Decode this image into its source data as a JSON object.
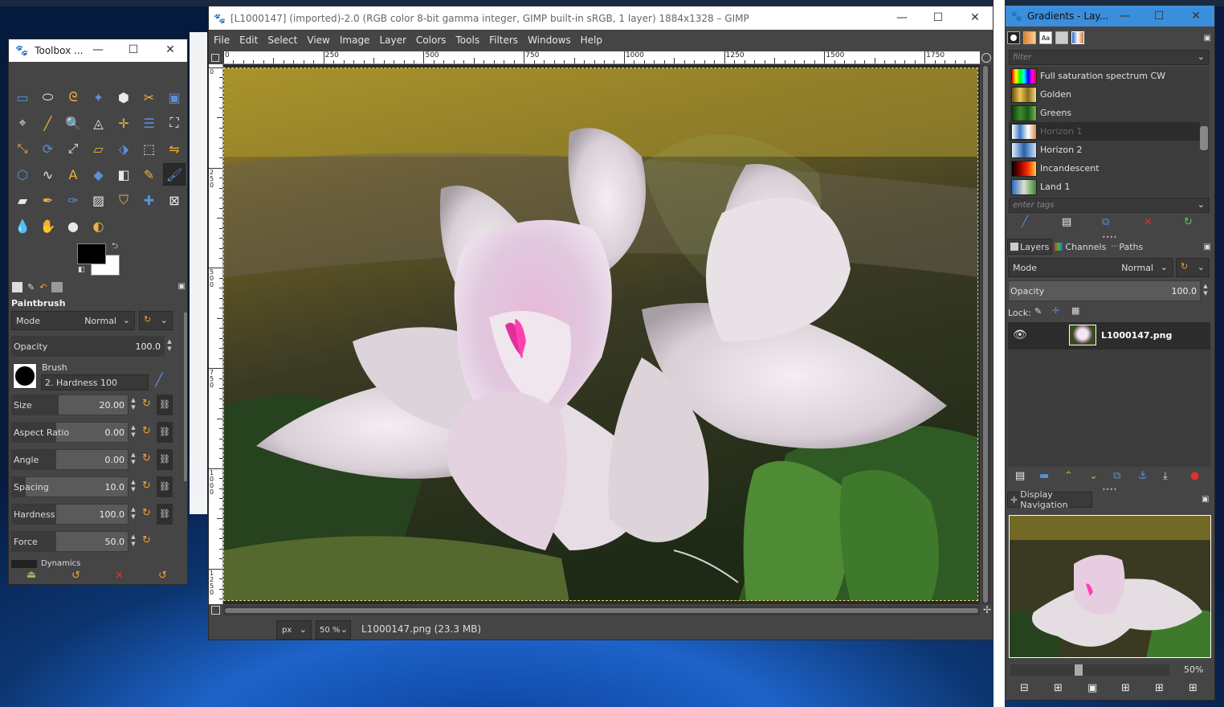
{
  "colors": {
    "accent": "#f0a030",
    "canvas_bg": "#2b2b2b",
    "panel": "#454545"
  },
  "toolbox": {
    "title": "Toolbox ...",
    "tools": [
      "rectangle-select",
      "ellipse-select",
      "free-select",
      "fuzzy-select",
      "select-by-color",
      "scissors-select",
      "foreground-select",
      "paths",
      "color-picker",
      "zoom",
      "measure",
      "move",
      "align",
      "crop",
      "unified-transform",
      "rotate",
      "scale",
      "shear",
      "perspective",
      "transform-3d",
      "flip",
      "cage-transform",
      "warp-transform",
      "text",
      "bucket-fill",
      "gradient",
      "pencil",
      "paintbrush",
      "eraser",
      "airbrush",
      "ink",
      "mypaint-brush",
      "clone",
      "heal",
      "perspective-clone",
      "smudge",
      "blur-sharpen",
      "dodge-burn",
      "handle-transform"
    ],
    "tool_options_title": "Paintbrush",
    "mode_label": "Mode",
    "mode_value": "Normal",
    "opacity_label": "Opacity",
    "opacity_value": "100.0",
    "brush_label": "Brush",
    "brush_value": "2. Hardness 100",
    "size_label": "Size",
    "size_value": "20.00",
    "aspect_label": "Aspect Ratio",
    "aspect_value": "0.00",
    "angle_label": "Angle",
    "angle_value": "0.00",
    "spacing_label": "Spacing",
    "spacing_value": "10.0",
    "hardness_label": "Hardness",
    "hardness_value": "100.0",
    "force_label": "Force",
    "force_value": "50.0",
    "dynamics_label": "Dynamics"
  },
  "image_window": {
    "title": "[L1000147] (imported)-2.0 (RGB color 8-bit gamma integer, GIMP built-in sRGB, 1 layer) 1884x1328 – GIMP",
    "menu": [
      "File",
      "Edit",
      "Select",
      "View",
      "Image",
      "Layer",
      "Colors",
      "Tools",
      "Filters",
      "Windows",
      "Help"
    ],
    "ruler_h": [
      "0",
      "250",
      "500",
      "750",
      "1000",
      "1250",
      "1500",
      "1750"
    ],
    "ruler_v": [
      "0",
      "250",
      "500",
      "750",
      "1000",
      "1250"
    ],
    "unit": "px",
    "zoom": "50 %",
    "status": "L1000147.png (23.3 MB)"
  },
  "dock": {
    "title": "Gradients - Lay...",
    "filter_placeholder": "filter",
    "tags_placeholder": "enter tags",
    "gradients": [
      {
        "name": "Full saturation spectrum CW",
        "colors": [
          "#ff0000",
          "#ffff00",
          "#00ff00",
          "#00ffff",
          "#0000ff",
          "#ff00ff",
          "#ff0000"
        ]
      },
      {
        "name": "Golden",
        "colors": [
          "#6b4e12",
          "#e8c85a",
          "#8a6a1c",
          "#f3dc80"
        ]
      },
      {
        "name": "Greens",
        "colors": [
          "#0d3a0d",
          "#3c8a2c",
          "#1b5a1b",
          "#6fb84a"
        ]
      },
      {
        "name": "Horizon 1",
        "colors": [
          "#ffffff",
          "#3a78c8",
          "#ffffff",
          "#d89050"
        ]
      },
      {
        "name": "Horizon 2",
        "colors": [
          "#e0f0ff",
          "#2860a8",
          "#c8e0f8"
        ]
      },
      {
        "name": "Incandescent",
        "colors": [
          "#000000",
          "#900000",
          "#ff3000",
          "#ffd040"
        ]
      },
      {
        "name": "Land 1",
        "colors": [
          "#2c6ac0",
          "#e0e0d0",
          "#3a8a30"
        ]
      }
    ],
    "tabs": [
      "Layers",
      "Channels",
      "Paths"
    ],
    "mode_label": "Mode",
    "mode_value": "Normal",
    "opacity_label": "Opacity",
    "opacity_value": "100.0",
    "lock_label": "Lock:",
    "layer_name": "L1000147.png",
    "nav_title": "Display Navigation",
    "nav_zoom": "50%"
  }
}
